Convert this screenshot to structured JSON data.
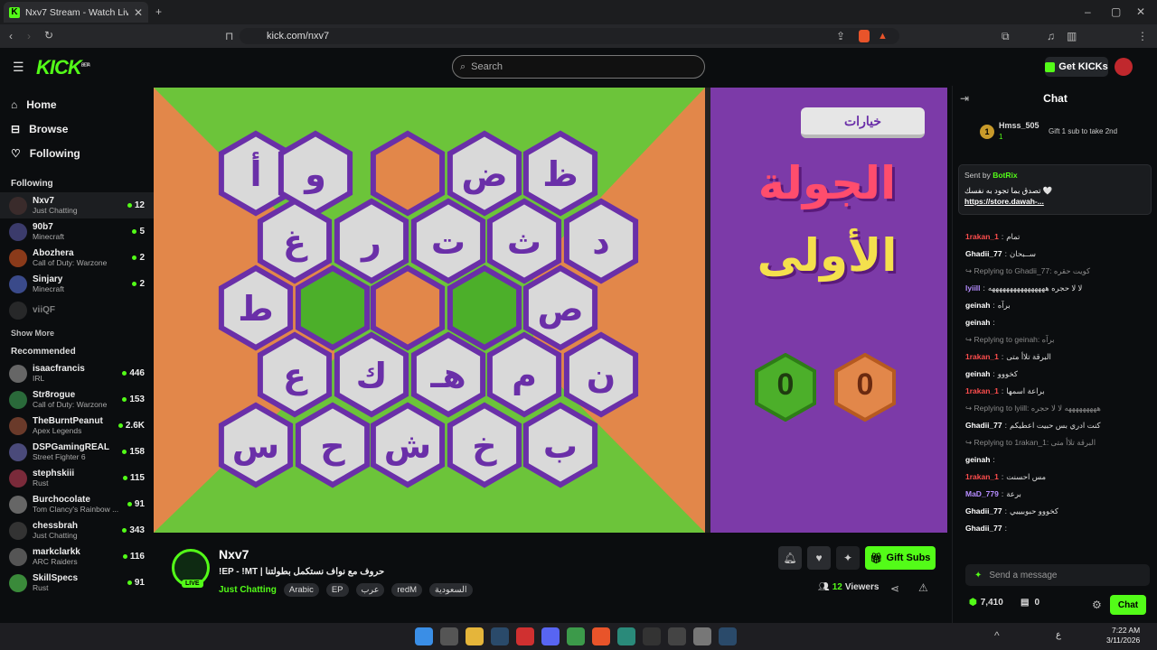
{
  "browser": {
    "tab_title": "Nxv7 Stream - Watch Live on",
    "url": "kick.com/nxv7"
  },
  "header": {
    "logo": "KICK",
    "logo_sup": "BETA",
    "search_placeholder": "Search",
    "get_kicks": "Get KICKs"
  },
  "nav": [
    {
      "label": "Home",
      "icon": "home-icon"
    },
    {
      "label": "Browse",
      "icon": "compass-icon"
    },
    {
      "label": "Following",
      "icon": "heart-icon"
    }
  ],
  "following_title": "Following",
  "following": [
    {
      "name": "Nxv7",
      "game": "Just Chatting",
      "count": "12",
      "color": "#3a2b2b"
    },
    {
      "name": "90b7",
      "game": "Minecraft",
      "count": "5",
      "color": "#3b3b6b"
    },
    {
      "name": "Abozhera",
      "game": "Call of Duty: Warzone",
      "count": "2",
      "color": "#8a3a1a"
    },
    {
      "name": "Sinjary",
      "game": "Minecraft",
      "count": "2",
      "color": "#3a4a8a"
    },
    {
      "name": "viiQF",
      "game": "",
      "count": "",
      "color": "#444"
    }
  ],
  "show_more": "Show More",
  "recommended_title": "Recommended",
  "recommended": [
    {
      "name": "isaacfrancis",
      "game": "IRL",
      "count": "446",
      "color": "#666"
    },
    {
      "name": "Str8rogue",
      "game": "Call of Duty: Warzone",
      "count": "153",
      "color": "#2a6a3a"
    },
    {
      "name": "TheBurntPeanut",
      "game": "Apex Legends",
      "count": "2.6K",
      "color": "#6a3a2a"
    },
    {
      "name": "DSPGamingREAL",
      "game": "Street Fighter 6",
      "count": "158",
      "color": "#4a4a7a"
    },
    {
      "name": "stephskiii",
      "game": "Rust",
      "count": "115",
      "color": "#7a2a3a"
    },
    {
      "name": "Burchocolate",
      "game": "Tom Clancy's Rainbow ...",
      "count": "91",
      "color": "#666"
    },
    {
      "name": "chessbrah",
      "game": "Just Chatting",
      "count": "343",
      "color": "#333"
    },
    {
      "name": "markclarkk",
      "game": "ARC Raiders",
      "count": "116",
      "color": "#555"
    },
    {
      "name": "SkillSpecs",
      "game": "Rust",
      "count": "91",
      "color": "#3a8a3a"
    }
  ],
  "game": {
    "options_button": "خيارات",
    "round_line1": "الجولة",
    "round_line2": "الأولى",
    "score_green": "0",
    "score_orange": "0",
    "rows": [
      [
        "أ",
        "و",
        "",
        "ض",
        "ظ"
      ],
      [
        "غ",
        "ر",
        "ت",
        "ث",
        "د"
      ],
      [
        "ط",
        "",
        "",
        "",
        "ص"
      ],
      [
        "ع",
        "ك",
        "هـ",
        "م",
        "ن"
      ],
      [
        "س",
        "ح",
        "ش",
        "خ",
        "ب"
      ]
    ]
  },
  "stream": {
    "name": "Nxv7",
    "title": "!EP - !MT | حروف مع نواف نستكمل بطولتنا",
    "category": "Just Chatting",
    "tags": [
      "Arabic",
      "EP",
      "عرب",
      "redM",
      "السعودية"
    ],
    "gift_subs": "Gift Subs",
    "viewers_count": "12",
    "viewers_label": "Viewers",
    "live": "LIVE"
  },
  "chat": {
    "title": "Chat",
    "pinned_user": "Hmss_505",
    "pinned_count": "1",
    "gift_text": "Gift 1 sub to take 2nd",
    "sent_by": "Sent by",
    "bot_name": "BotRix",
    "bot_msg": "تصدق بما تجود به نفسك 🤍",
    "bot_link": "https://store.dawah-...",
    "messages": [
      {
        "user": "1rakan_1",
        "color": "#ff4d4d",
        "text": "تمام"
      },
      {
        "user": "Ghadii_77",
        "color": "#ffffff",
        "text": "ســبحان"
      },
      {
        "user": "",
        "color": "#888",
        "text": "↪ Replying to Ghadii_77: كويت حقره"
      },
      {
        "user": "lyiill",
        "color": "#b58cff",
        "text": "لا لا حجره ههههههههههههههههه"
      },
      {
        "user": "geinah",
        "color": "#ffffff",
        "text": "برآه"
      },
      {
        "user": "geinah",
        "color": "#ffffff",
        "text": ""
      },
      {
        "user": "",
        "color": "#888",
        "text": "↪ Replying to geinah: برآه"
      },
      {
        "user": "1rakan_1",
        "color": "#ff4d4d",
        "text": "البرقة تلاأ متى"
      },
      {
        "user": "geinah",
        "color": "#ffffff",
        "text": "كخووو"
      },
      {
        "user": "1rakan_1",
        "color": "#ff4d4d",
        "text": "براعة اسمها"
      },
      {
        "user": "",
        "color": "#888",
        "text": "↪ Replying to lyiill: هههههههههه لا لا حجره"
      },
      {
        "user": "Ghadii_77",
        "color": "#ffffff",
        "text": "كنت ادري بس حبيت اعطيكم"
      },
      {
        "user": "",
        "color": "#888",
        "text": "↪ Replying to 1rakan_1: البرقة تلاأ متى"
      },
      {
        "user": "geinah",
        "color": "#ffffff",
        "text": ""
      },
      {
        "user": "1rakan_1",
        "color": "#ff4d4d",
        "text": "مس احسنت"
      },
      {
        "user": "MaD_779",
        "color": "#b58cff",
        "text": "برعة"
      },
      {
        "user": "Ghadii_77",
        "color": "#ffffff",
        "text": "كخووو حبوبيييي"
      },
      {
        "user": "Ghadii_77",
        "color": "#ffffff",
        "text": ""
      }
    ],
    "send_placeholder": "Send a message",
    "points": "7,410",
    "other_count": "0",
    "chat_button": "Chat"
  },
  "taskbar": {
    "time": "7:22 AM",
    "date": "3/11/2026",
    "lang": "ع"
  },
  "colors": {
    "kick_green": "#53fc18",
    "hex_fill": "#d9d9d9",
    "hex_border": "#6a2fa8",
    "bg_green": "#6cc43a",
    "bg_orange": "#e2874a",
    "panel_purple": "#7c3aa8"
  }
}
